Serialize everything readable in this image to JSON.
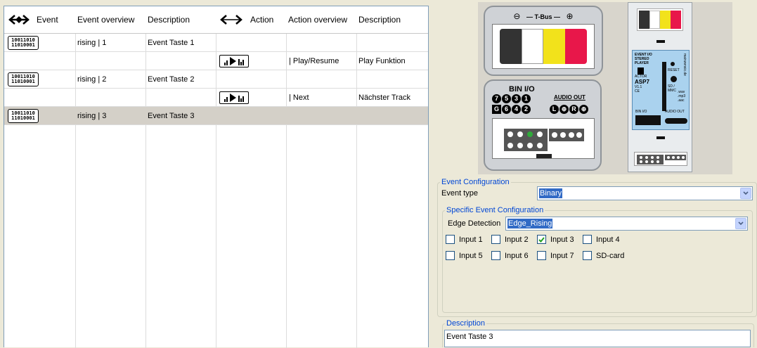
{
  "grid": {
    "headers": {
      "event": "Event",
      "event_overview": "Event overview",
      "event_description": "Description",
      "action": "Action",
      "action_overview": "Action overview",
      "action_description": "Description"
    },
    "rows": [
      {
        "kind": "event",
        "overview": "rising | 1",
        "description": "Event Taste 1"
      },
      {
        "kind": "action",
        "overview": "| Play/Resume",
        "description": "Play Funktion"
      },
      {
        "kind": "event",
        "overview": "rising | 2",
        "description": "Event Taste 2"
      },
      {
        "kind": "action",
        "overview": "| Next",
        "description": "Nächster Track"
      },
      {
        "kind": "event",
        "overview": "rising | 3",
        "description": "Event Taste 3",
        "selected": true
      }
    ],
    "binary_icon_lines": [
      "10011010",
      "11010001"
    ]
  },
  "device": {
    "tbus_label": "T-Bus",
    "tbus_minus": "⊖",
    "tbus_plus": "⊕",
    "colors": [
      "#333333",
      "#ffffff",
      "#f2e21b",
      "#e8174a"
    ],
    "binio_title": "BIN I/O",
    "binio_top": [
      "7",
      "5",
      "3",
      "1"
    ],
    "binio_bottom_g": "G",
    "binio_bottom": [
      "6",
      "4",
      "2"
    ],
    "audio_out": "AUDIO OUT",
    "audio_symbols": [
      "L",
      "⊕",
      "R",
      "⊕"
    ],
    "module_label": "EVENT I/O STEREO PLAYER",
    "module_actor": "ACTOR",
    "module_model": "ASP7",
    "module_version": "V1.1",
    "module_ce": "CE",
    "module_site": "mainzensic.de",
    "module_reset": "RESET",
    "module_sd": "SD / MMC",
    "module_formats": ".wav .mp3 .aac",
    "module_binio": "BIN I/O",
    "module_audio": "AUDIO OUT"
  },
  "event_config": {
    "legend": "Event Configuration",
    "event_type_label": "Event type",
    "event_type_value": "Binary",
    "specific": {
      "legend": "Specific Event Configuration",
      "edge_label": "Edge Detection",
      "edge_value": "Edge_Rising",
      "inputs": [
        {
          "label": "Input 1",
          "checked": false
        },
        {
          "label": "Input 2",
          "checked": false
        },
        {
          "label": "Input 3",
          "checked": true
        },
        {
          "label": "Input 4",
          "checked": false
        },
        {
          "label": "Input 5",
          "checked": false
        },
        {
          "label": "Input 6",
          "checked": false
        },
        {
          "label": "Input 7",
          "checked": false
        },
        {
          "label": "SD-card",
          "checked": false
        }
      ]
    }
  },
  "description": {
    "legend": "Description",
    "value": "Event Taste 3"
  }
}
